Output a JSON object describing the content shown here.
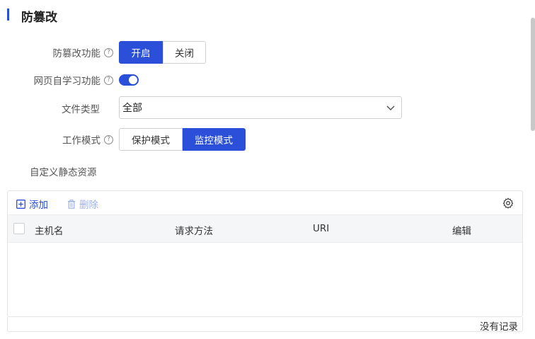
{
  "page": {
    "title": "防篡改"
  },
  "form": {
    "tamper_label": "防篡改功能",
    "tamper_options": [
      "开启",
      "关闭"
    ],
    "tamper_selected": "开启",
    "selflearn_label": "网页自学习功能",
    "selflearn_enabled": true,
    "filetype_label": "文件类型",
    "filetype_value": "全部",
    "workmode_label": "工作模式",
    "workmode_options": [
      "保护模式",
      "监控模式"
    ],
    "workmode_selected": "监控模式",
    "static_resource_label": "自定义静态资源",
    "help_glyph": "?"
  },
  "grid": {
    "add_label": "添加",
    "delete_label": "删除",
    "columns": [
      "主机名",
      "请求方法",
      "URI",
      "编辑"
    ],
    "rows": [],
    "empty_text": "没有记录"
  },
  "colors": {
    "accent": "#2b4fd8",
    "disabled_text": "#9db1ec"
  }
}
